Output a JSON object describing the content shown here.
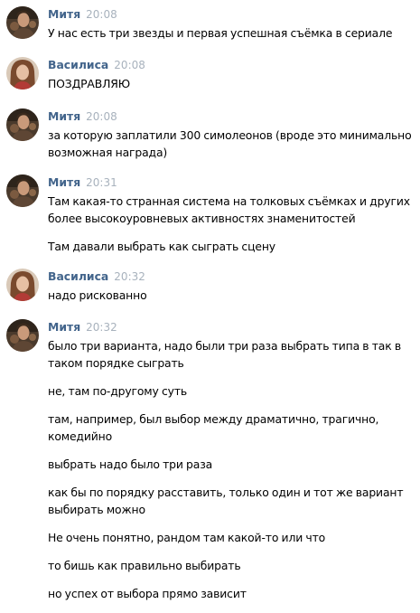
{
  "messages": [
    {
      "author": "Митя",
      "time": "20:08",
      "avatar": "male-avatar",
      "texts": [
        "У нас есть три звезды и первая успешная съёмка в сериале"
      ]
    },
    {
      "author": "Василиса",
      "time": "20:08",
      "avatar": "female-avatar",
      "texts": [
        "ПОЗДРАВЛЯЮ"
      ]
    },
    {
      "author": "Митя",
      "time": "20:08",
      "avatar": "male-avatar",
      "texts": [
        "за которую заплатили 300 симолеонов (вроде это минимально возможная награда)"
      ]
    },
    {
      "author": "Митя",
      "time": "20:31",
      "avatar": "male-avatar",
      "texts": [
        "Там какая-то странная система на толковых съёмках и других более высокоуровневых активностях знаменитостей",
        "Там давали выбрать как сыграть сцену"
      ]
    },
    {
      "author": "Василиса",
      "time": "20:32",
      "avatar": "female-avatar",
      "texts": [
        "надо рискованно"
      ]
    },
    {
      "author": "Митя",
      "time": "20:32",
      "avatar": "male-avatar",
      "texts": [
        "было три варианта, надо были три раза выбрать типа в так в таком порядке сыграть",
        "не, там по-другому суть",
        "там, например, был выбор между драматично, трагично, комедийно",
        "выбрать надо было три раза",
        "как бы по порядку расставить, только один и тот же вариант выбирать можно",
        "Не очень понятно, рандом там какой-то или что",
        "то бишь как правильно выбирать",
        "но успех от выбора прямо зависит"
      ]
    }
  ]
}
